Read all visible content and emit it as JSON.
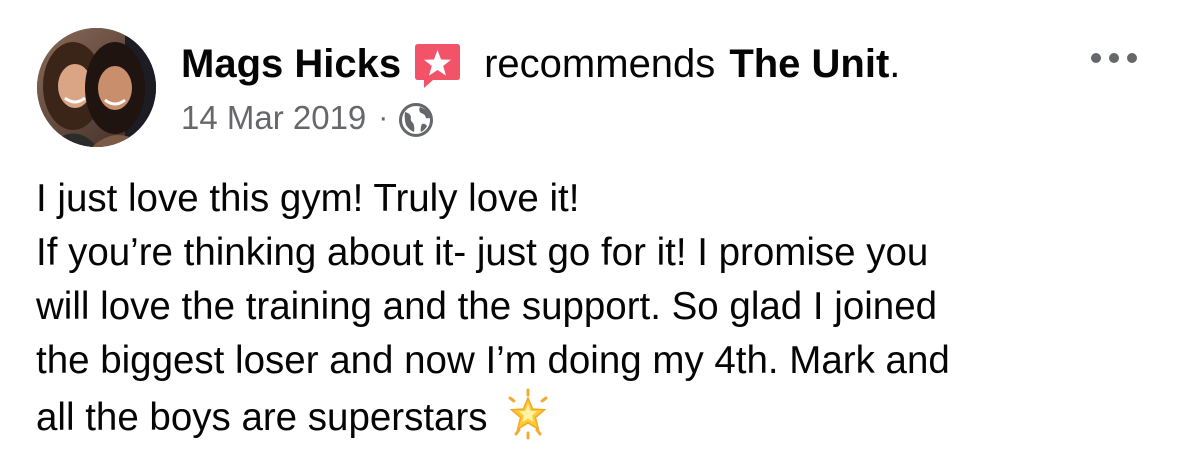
{
  "post": {
    "author": "Mags Hicks",
    "action_text": "recommends",
    "page_name": "The Unit",
    "period": ".",
    "date": "14 Mar 2019",
    "separator": "·",
    "audience_icon": "globe-icon",
    "recommend_icon": "recommend-star-icon",
    "more_icon": "more-options-icon",
    "body_lines": [
      "I just love this gym! Truly love it!",
      "If you’re thinking about it- just go for it! I promise you",
      "will love the training and the support. So glad I joined",
      "the biggest loser and now I’m doing my 4th. Mark and",
      "all the boys are superstars"
    ],
    "trailing_emoji": "glowing-star-emoji"
  },
  "colors": {
    "text_primary": "#050505",
    "text_secondary": "#65676b",
    "recommend_red": "#f35369",
    "background": "#ffffff"
  }
}
